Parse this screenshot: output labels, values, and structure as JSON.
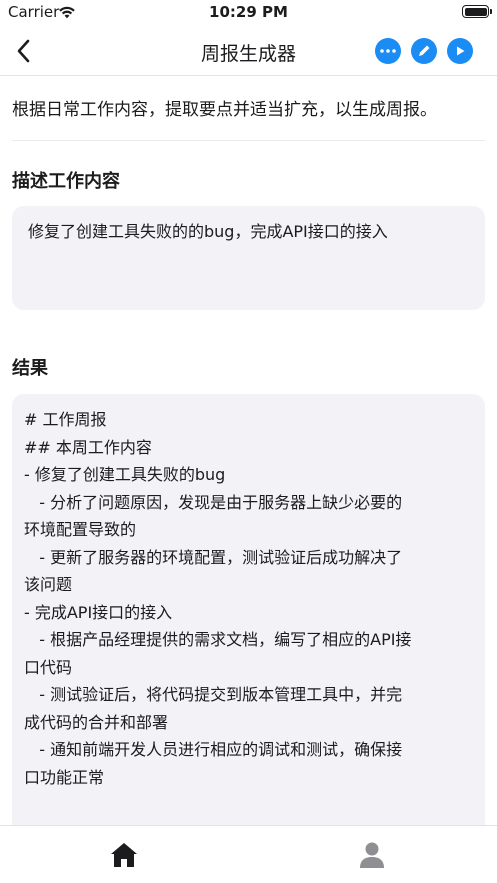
{
  "status_bar": {
    "carrier": "Carrier",
    "time": "10:29 PM"
  },
  "nav": {
    "title": "周报生成器",
    "actions": [
      {
        "icon": "more-icon"
      },
      {
        "icon": "edit-icon"
      },
      {
        "icon": "play-icon"
      }
    ]
  },
  "intro": "根据日常工作内容，提取要点并适当扩充，以生成周报。",
  "input_section": {
    "title": "描述工作内容",
    "value": "修复了创建工具失败的的bug，完成API接口的接入"
  },
  "result_section": {
    "title": "结果",
    "lines": [
      "# 工作周报",
      "",
      "## 本周工作内容",
      "",
      "- 修复了创建工具失败的bug",
      "   - 分析了问题原因，发现是由于服务器上缺少必要的",
      "环境配置导致的",
      "   - 更新了服务器的环境配置，测试验证后成功解决了",
      "该问题",
      "- 完成API接口的接入",
      "   - 根据产品经理提供的需求文档，编写了相应的API接",
      "口代码",
      "   - 测试验证后，将代码提交到版本管理工具中，并完",
      "成代码的合并和部署",
      "   - 通知前端开发人员进行相应的调试和测试，确保接",
      "口功能正常"
    ]
  },
  "tab_bar": {
    "tabs": [
      {
        "icon": "home-icon",
        "active": true
      },
      {
        "icon": "profile-icon",
        "active": false
      }
    ]
  },
  "colors": {
    "accent": "#1a8cf4",
    "panel": "#f2f2f7",
    "text": "#1c1c1e",
    "inactive": "#8e8e93"
  }
}
